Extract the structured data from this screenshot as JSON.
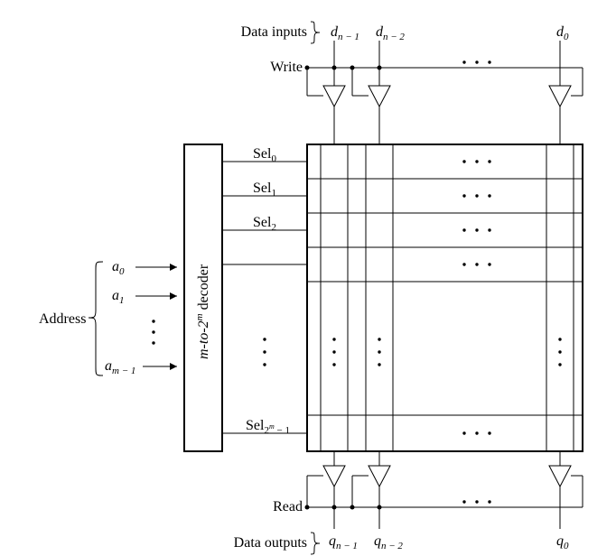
{
  "labels": {
    "data_inputs": "Data inputs",
    "write": "Write",
    "read": "Read",
    "data_outputs": "Data outputs",
    "address": "Address",
    "decoder": "m-to-2",
    "decoder_sup": "m",
    "decoder_tail": " decoder",
    "d": "d",
    "q": "q",
    "a": "a",
    "n1": "n − 1",
    "n2": "n − 2",
    "zero": "0",
    "one": "1",
    "two": "2",
    "m1": "m − 1",
    "sel": "Sel",
    "sel_last_base": "2",
    "sel_last_sup": "m",
    "sel_last_tail": " − 1"
  }
}
